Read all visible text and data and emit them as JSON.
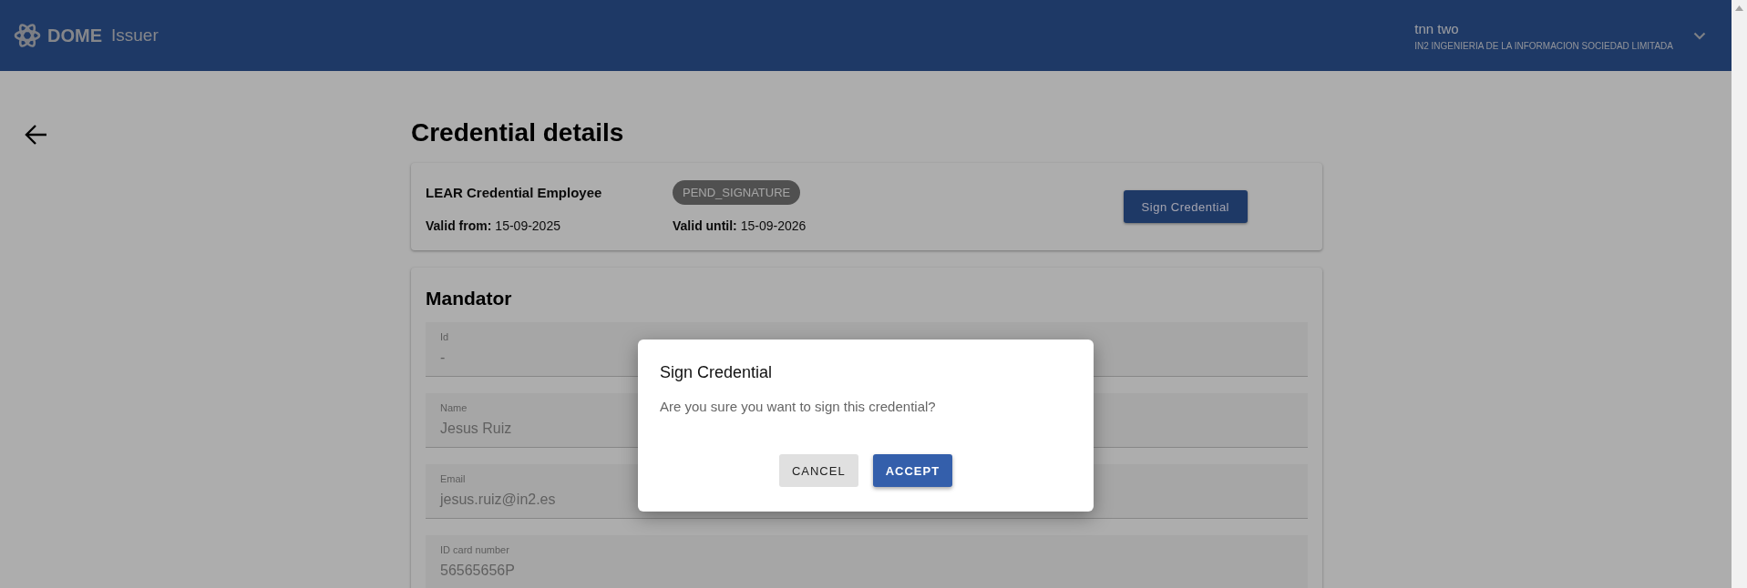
{
  "header": {
    "logo_text": "DOME",
    "app_name": "Issuer",
    "user_name": "tnn two",
    "organization": "IN2 INGENIERIA DE LA INFORMACION SOCIEDAD LIMITADA"
  },
  "page": {
    "title": "Credential details"
  },
  "credential": {
    "type": "LEAR Credential Employee",
    "status": "PEND_SIGNATURE",
    "valid_from_label": "Valid from:",
    "valid_from": "15-09-2025",
    "valid_until_label": "Valid until:",
    "valid_until": "15-09-2026",
    "action": "Sign Credential"
  },
  "mandator": {
    "title": "Mandator",
    "fields": [
      {
        "label": "Id",
        "value": "-",
        "disabled": true
      },
      {
        "label": "Name",
        "value": "Jesus Ruiz",
        "disabled": true
      },
      {
        "label": "Email",
        "value": "jesus.ruiz@in2.es",
        "disabled": true
      },
      {
        "label": "ID card number",
        "value": "56565656P",
        "disabled": true
      }
    ]
  },
  "dialog": {
    "title": "Sign Credential",
    "message": "Are you sure you want to sign this credential?",
    "buttons": [
      {
        "label": "CANCEL",
        "kind": "secondary"
      },
      {
        "label": "ACCEPT",
        "kind": "primary"
      }
    ]
  }
}
